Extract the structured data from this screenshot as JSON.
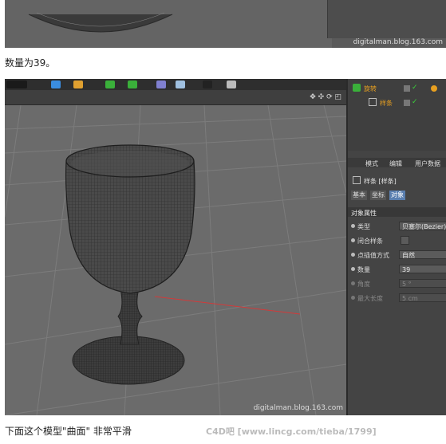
{
  "top_caption": "数量为39。",
  "bottom_caption": "下面这个模型\"曲面\" 非常平滑",
  "footer_watermark": "C4D吧 [www.lincg.com/tieba/1799]",
  "watermark": "digitalman.blog.163.com",
  "viewport": {
    "nav_icons": "✥ ✣ ⟳ ◰"
  },
  "object_manager": {
    "items": [
      {
        "name": "旋转"
      },
      {
        "name": "样条"
      }
    ]
  },
  "attribute_manager": {
    "menu": [
      "模式",
      "编辑",
      "用户数据"
    ],
    "object_title": "样条 [样条]",
    "tabs": [
      "基本",
      "坐标",
      "对象"
    ],
    "section": "对象属性",
    "properties": [
      {
        "label": "类型",
        "value": "贝塞尔(Bezier)"
      },
      {
        "label": "闭合样条",
        "value": ""
      },
      {
        "label": "点插值方式",
        "value": "自然"
      },
      {
        "label": "数量",
        "value": "39"
      },
      {
        "label": "角度",
        "value": "5 °"
      },
      {
        "label": "最大长度",
        "value": "5 cm"
      }
    ]
  },
  "colors": {
    "viewport_bg": "#6b6b6b",
    "panel_bg": "#444444",
    "accent_orange": "#e8a020",
    "selected_tab": "#5a7fb0",
    "axis_green": "#3ad23a",
    "axis_red": "#d23a3a"
  }
}
